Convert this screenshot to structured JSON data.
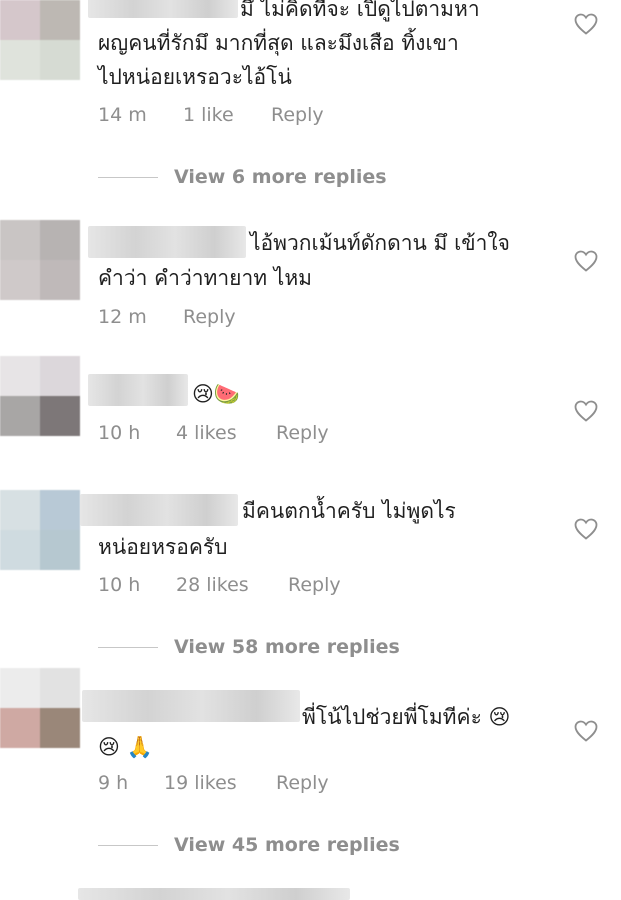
{
  "comments": [
    {
      "text_lines": [
        "มึ ไม่คิดที่จะ เปิดูไปตามหา",
        "ผญคนที่รักมึ มากที่สุด และมึงเสือ ทิ้งเขา",
        "ไปหน่อยเหรอวะไอ้โน่"
      ],
      "time": "14 m",
      "likes": "1 like",
      "reply": "Reply",
      "avatar": [
        "#d5c7cb",
        "#bdb8b3",
        "#dfe3dc",
        "#d6dbd3"
      ]
    },
    {
      "text_lines": [
        "ไอ้พวกเม้นท์ดักดาน มึ เข้าใจ",
        "คำว่า คำว่าทายาท ไหม"
      ],
      "time": "12 m",
      "likes": "",
      "reply": "Reply",
      "avatar": [
        "#c9c5c4",
        "#b7b3b2",
        "#cfc9c9",
        "#bfb9b9"
      ]
    },
    {
      "text_lines": [
        "😢🍉"
      ],
      "time": "10 h",
      "likes": "4 likes",
      "reply": "Reply",
      "avatar": [
        "#e7e4e6",
        "#dcd7db",
        "#a8a6a5",
        "#7d7778"
      ]
    },
    {
      "text_lines": [
        "มีคนตกน้ำครับ ไม่พูดไร",
        "หน่อยหรอครับ"
      ],
      "time": "10 h",
      "likes": "28 likes",
      "reply": "Reply",
      "avatar": [
        "#d7e0e3",
        "#b8c9d6",
        "#cfdbe0",
        "#b6c8d0"
      ]
    },
    {
      "text_lines": [
        "พี่โน้ไปช่วยพี่โมทีค่ะ 😢",
        "😢 🙏"
      ],
      "time": "9 h",
      "likes": "19 likes",
      "reply": "Reply",
      "avatar": [
        "#ececec",
        "#e2e2e2",
        "#cfa9a3",
        "#9a8779"
      ]
    }
  ],
  "view_more": [
    "View 6 more replies",
    "View 58 more replies",
    "View 45 more replies"
  ],
  "colors": {
    "text": "#262626",
    "meta": "#8e8e8e",
    "heart": "#8e8e8e"
  },
  "icons": {
    "like": "heart-outline-icon"
  }
}
